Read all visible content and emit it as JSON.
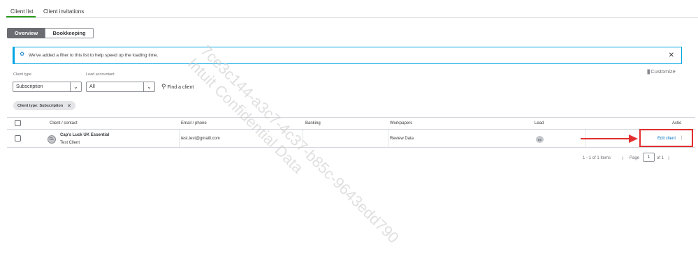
{
  "tabs": [
    {
      "label": "Client list"
    },
    {
      "label": "Client invitations"
    }
  ],
  "view_toggle": {
    "overview": "Overview",
    "bookkeeping": "Bookkeeping"
  },
  "banner": {
    "text": "We've added a filter to this list to help speed up the loading time."
  },
  "customize_label": "Customize",
  "filters": {
    "client_type_label": "Client type",
    "client_type_value": "Subscription",
    "lead_accountant_label": "Lead accountant",
    "lead_accountant_value": "All",
    "find_client_placeholder": "Find a client"
  },
  "active_filter_chip": "Client type: Subscription",
  "table": {
    "headers": {
      "client": "Client / contact",
      "email": "Email / phone",
      "banking": "Banking",
      "workpapers": "Workpapers",
      "lead": "Lead",
      "action": "Actio"
    },
    "rows": [
      {
        "avatar": "CL",
        "client_name": "Cap's Luck UK Essential",
        "contact": "Test Client",
        "email": "test.test@gmaill.com",
        "banking": "",
        "workpapers": "Review Data",
        "lead": "EE",
        "action": "Edit client"
      }
    ]
  },
  "pagination": {
    "range": "1 - 1 of 1 Items",
    "page_label": "Page",
    "page_value": "1",
    "of_label": "of 1"
  },
  "watermark": {
    "line1": "7ce3c144-a3c7-4c37-b85c-9643edd790",
    "line2": "Intuit Confidential Data"
  },
  "colors": {
    "accent": "#2ca01c",
    "link": "#0077c5",
    "highlight": "#e2302f",
    "banner_border": "#00a6e4"
  }
}
